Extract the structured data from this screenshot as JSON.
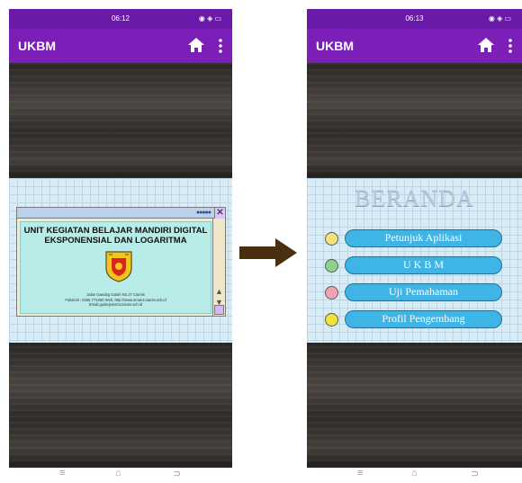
{
  "left_screen": {
    "status": {
      "time": "06:12",
      "icons": "◉ ◈ ▭"
    },
    "app_title": "UKBM",
    "cover": {
      "heading": "UNIT KEGIATAN BELAJAR MANDIRI DIGITAL\nEKSPONENSIAL DAN LOGARITMA",
      "address": "Jalan Gandog Galuh No.37 Ciamis\nFaksimil : 0265 771060 Web.:http://www.sman1ciamis.sch.id\nEmail:guidejsman1ciamis.sch.id",
      "window_dots": "●●●●●",
      "close": "✕",
      "scroll_up": "▲",
      "scroll_down": "▼"
    }
  },
  "right_screen": {
    "status": {
      "time": "06:13",
      "icons": "◉ ◈ ▭"
    },
    "app_title": "UKBM",
    "title": "BERANDA",
    "menu": [
      {
        "label": "Petunjuk Aplikasi",
        "bullet_color": "#f6e27a"
      },
      {
        "label": "U K B M",
        "bullet_color": "#8ed08e"
      },
      {
        "label": "Uji Pemahaman",
        "bullet_color": "#f2a3b3"
      },
      {
        "label": "Profil Pengembang",
        "bullet_color": "#f2e23a"
      }
    ]
  },
  "nav": {
    "menu": "≡",
    "home": "⌂",
    "back": "⊃"
  },
  "colors": {
    "appbar": "#7b1fb8",
    "statusbar": "#6a1aa8",
    "button": "#3fb5e6"
  }
}
